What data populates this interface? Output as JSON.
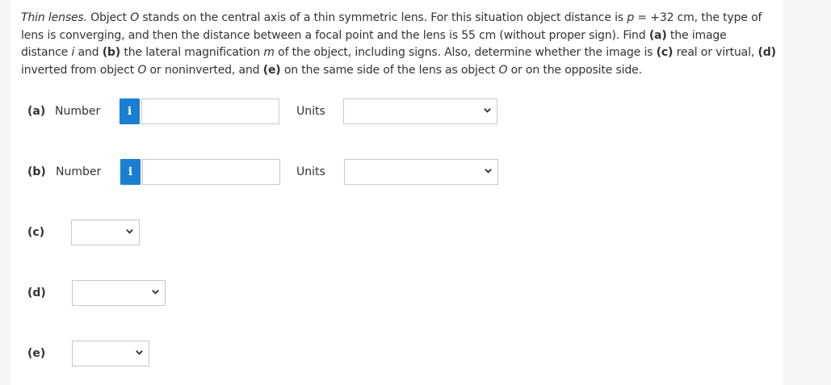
{
  "question": {
    "lead_italic": "Thin lenses.",
    "text_1": " Object ",
    "obj_1": "O",
    "text_2": " stands on the central axis of a thin symmetric lens. For this situation object distance is ",
    "p_var": "p",
    "text_3": " = +32 cm, the type of lens is converging, and then the distance between a focal point and the lens is 55 cm (without proper sign). Find ",
    "part_a": "(a)",
    "text_4": " the image distance ",
    "i_var": "i",
    "text_5": " and ",
    "part_b": "(b)",
    "text_6": " the lateral magnification ",
    "m_var": "m",
    "text_7": " of the object, including signs. Also, determine whether the image is ",
    "part_c": "(c)",
    "text_8": " real or virtual, ",
    "part_d": "(d)",
    "text_9": " inverted from object ",
    "obj_2": "O",
    "text_10": " or noninverted, and ",
    "part_e": "(e)",
    "text_11": " on the same side of the lens as object ",
    "obj_3": "O",
    "text_12": " or on the opposite side."
  },
  "parts": {
    "a": {
      "label": "(a)",
      "number_label": "Number",
      "info": "i",
      "value": "",
      "units_label": "Units",
      "units_value": ""
    },
    "b": {
      "label": "(b)",
      "number_label": "Number",
      "info": "i",
      "value": "",
      "units_label": "Units",
      "units_value": ""
    },
    "c": {
      "label": "(c)",
      "value": ""
    },
    "d": {
      "label": "(d)",
      "value": ""
    },
    "e": {
      "label": "(e)",
      "value": ""
    }
  },
  "colors": {
    "info_button": "#1a7fd0",
    "border": "#c9c9c9",
    "text": "#333333",
    "page_bg": "#f5f5f5"
  },
  "icons": {
    "info": "info-icon",
    "dropdown": "chevron-down-icon"
  }
}
